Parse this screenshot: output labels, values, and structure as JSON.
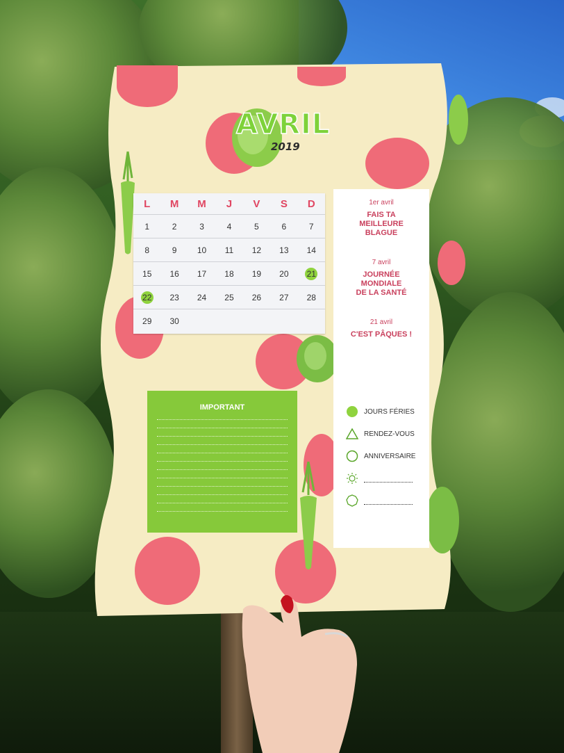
{
  "month": "AVRIL",
  "year": "2019",
  "calendar": {
    "weekdays": [
      "L",
      "M",
      "M",
      "J",
      "V",
      "S",
      "D"
    ],
    "weeks": [
      [
        "1",
        "2",
        "3",
        "4",
        "5",
        "6",
        "7"
      ],
      [
        "8",
        "9",
        "10",
        "11",
        "12",
        "13",
        "14"
      ],
      [
        "15",
        "16",
        "17",
        "18",
        "19",
        "20",
        "21"
      ],
      [
        "22",
        "23",
        "24",
        "25",
        "26",
        "27",
        "28"
      ],
      [
        "29",
        "30",
        "",
        "",
        "",
        "",
        ""
      ]
    ],
    "holidays": [
      "21",
      "22"
    ]
  },
  "events": [
    {
      "date": "1er avril",
      "name": "FAIS TA\nMEILLEURE\nBLAGUE"
    },
    {
      "date": "7 avril",
      "name": "JOURNÉE\nMONDIALE\nDE LA SANTÉ"
    },
    {
      "date": "21 avril",
      "name": "C'EST PÂQUES !"
    }
  ],
  "legend": [
    {
      "icon": "filled-circle-icon",
      "label": "JOURS FÉRIES"
    },
    {
      "icon": "triangle-icon",
      "label": "RENDEZ-VOUS"
    },
    {
      "icon": "circle-icon",
      "label": "ANNIVERSAIRE"
    },
    {
      "icon": "sun-icon",
      "label": ""
    },
    {
      "icon": "flower-icon",
      "label": ""
    }
  ],
  "important_title": "IMPORTANT",
  "colors": {
    "accent_green": "#86c93a",
    "accent_pink": "#e04662",
    "paper": "#f6ecc4",
    "dots": "#ef6b78"
  }
}
